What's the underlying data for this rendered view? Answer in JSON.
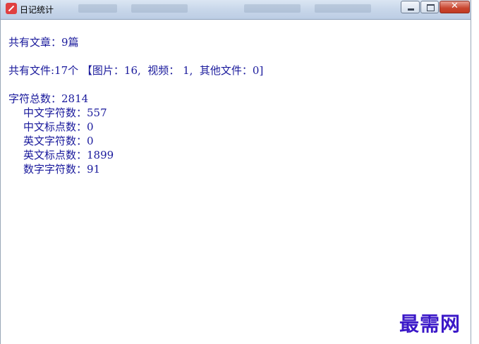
{
  "window": {
    "title": "日记统计"
  },
  "stats": {
    "articles": "共有文章：9篇",
    "files": "共有文件:17个 【图片：16,  视频： 1,  其他文件：0]",
    "total_chars": "字符总数：2814",
    "details": [
      "中文字符数：557",
      "中文标点数：0",
      "英文字符数：0",
      "英文标点数：1899",
      "数字字符数：91"
    ]
  },
  "watermark": "最需网"
}
